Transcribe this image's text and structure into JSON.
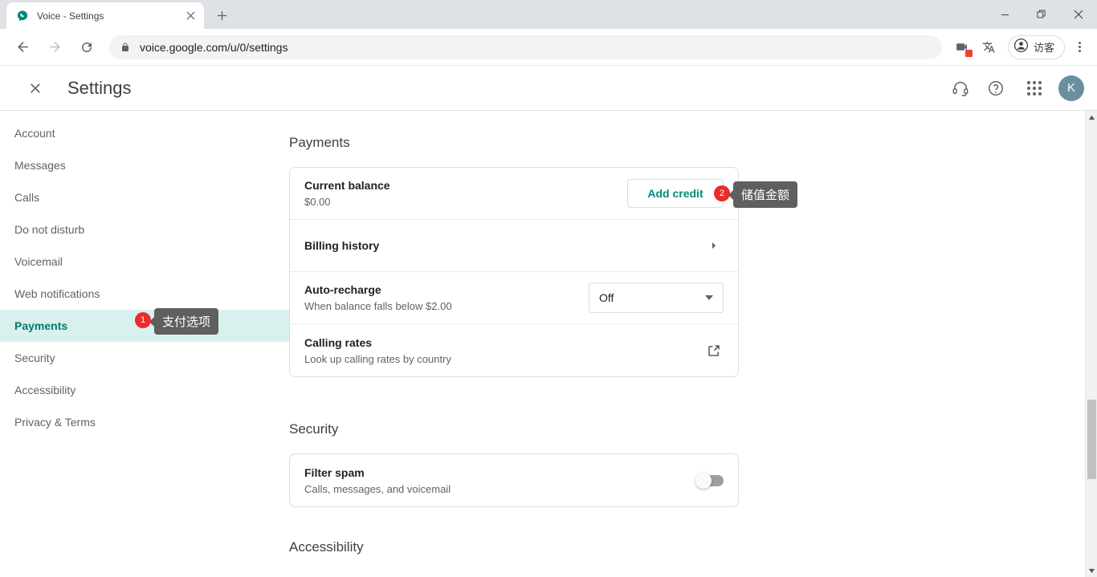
{
  "browser": {
    "tab": {
      "title": "Voice - Settings",
      "favicon": "google-voice-icon",
      "close": "×"
    },
    "new_tab_label": "+",
    "window_controls": {
      "minimize": "minimize-icon",
      "maximize": "maximize-icon",
      "close": "close-icon"
    },
    "nav": {
      "back": "back-arrow-icon",
      "forward": "forward-arrow-icon",
      "reload": "reload-icon"
    },
    "omnibox": {
      "lock": "lock-icon",
      "url": "voice.google.com/u/0/settings"
    },
    "toolbar_icons": {
      "camera": "camera-blocked-icon",
      "translate": "translate-icon"
    },
    "profile": {
      "name": "访客",
      "avatar": "person-icon"
    },
    "menu": "three-dots-menu-icon"
  },
  "app": {
    "close_label": "×",
    "title": "Settings",
    "header_icons": {
      "support": "headset-icon",
      "help": "help-circle-icon",
      "apps": "apps-grid-icon"
    },
    "avatar_letter": "K"
  },
  "sidebar": {
    "items": [
      {
        "label": "Account",
        "active": false
      },
      {
        "label": "Messages",
        "active": false
      },
      {
        "label": "Calls",
        "active": false
      },
      {
        "label": "Do not disturb",
        "active": false
      },
      {
        "label": "Voicemail",
        "active": false
      },
      {
        "label": "Web notifications",
        "active": false
      },
      {
        "label": "Payments",
        "active": true
      },
      {
        "label": "Security",
        "active": false
      },
      {
        "label": "Accessibility",
        "active": false
      },
      {
        "label": "Privacy & Terms",
        "active": false
      }
    ],
    "payments_badge": "1",
    "payments_tooltip": "支付选项"
  },
  "payments": {
    "heading": "Payments",
    "balance": {
      "title": "Current balance",
      "amount": "$0.00"
    },
    "add_credit": {
      "label": "Add credit",
      "badge": "2",
      "tooltip": "储值金额"
    },
    "billing_history": {
      "title": "Billing history",
      "chevron": "chevron-right-icon"
    },
    "auto_recharge": {
      "title": "Auto-recharge",
      "subtitle": "When balance falls below $2.00",
      "selected": "Off",
      "options": [
        "Off"
      ]
    },
    "calling_rates": {
      "title": "Calling rates",
      "subtitle": "Look up calling rates by country",
      "icon": "external-link-icon"
    }
  },
  "security": {
    "heading": "Security",
    "filter_spam": {
      "title": "Filter spam",
      "subtitle": "Calls, messages, and voicemail",
      "enabled": false
    }
  },
  "accessibility": {
    "heading": "Accessibility"
  },
  "colors": {
    "accent_teal": "#00796b",
    "active_bg": "#d9f0ee",
    "badge_red": "#ea2b2b",
    "tooltip_bg": "#5f5f5f",
    "link_teal": "#00897b"
  }
}
